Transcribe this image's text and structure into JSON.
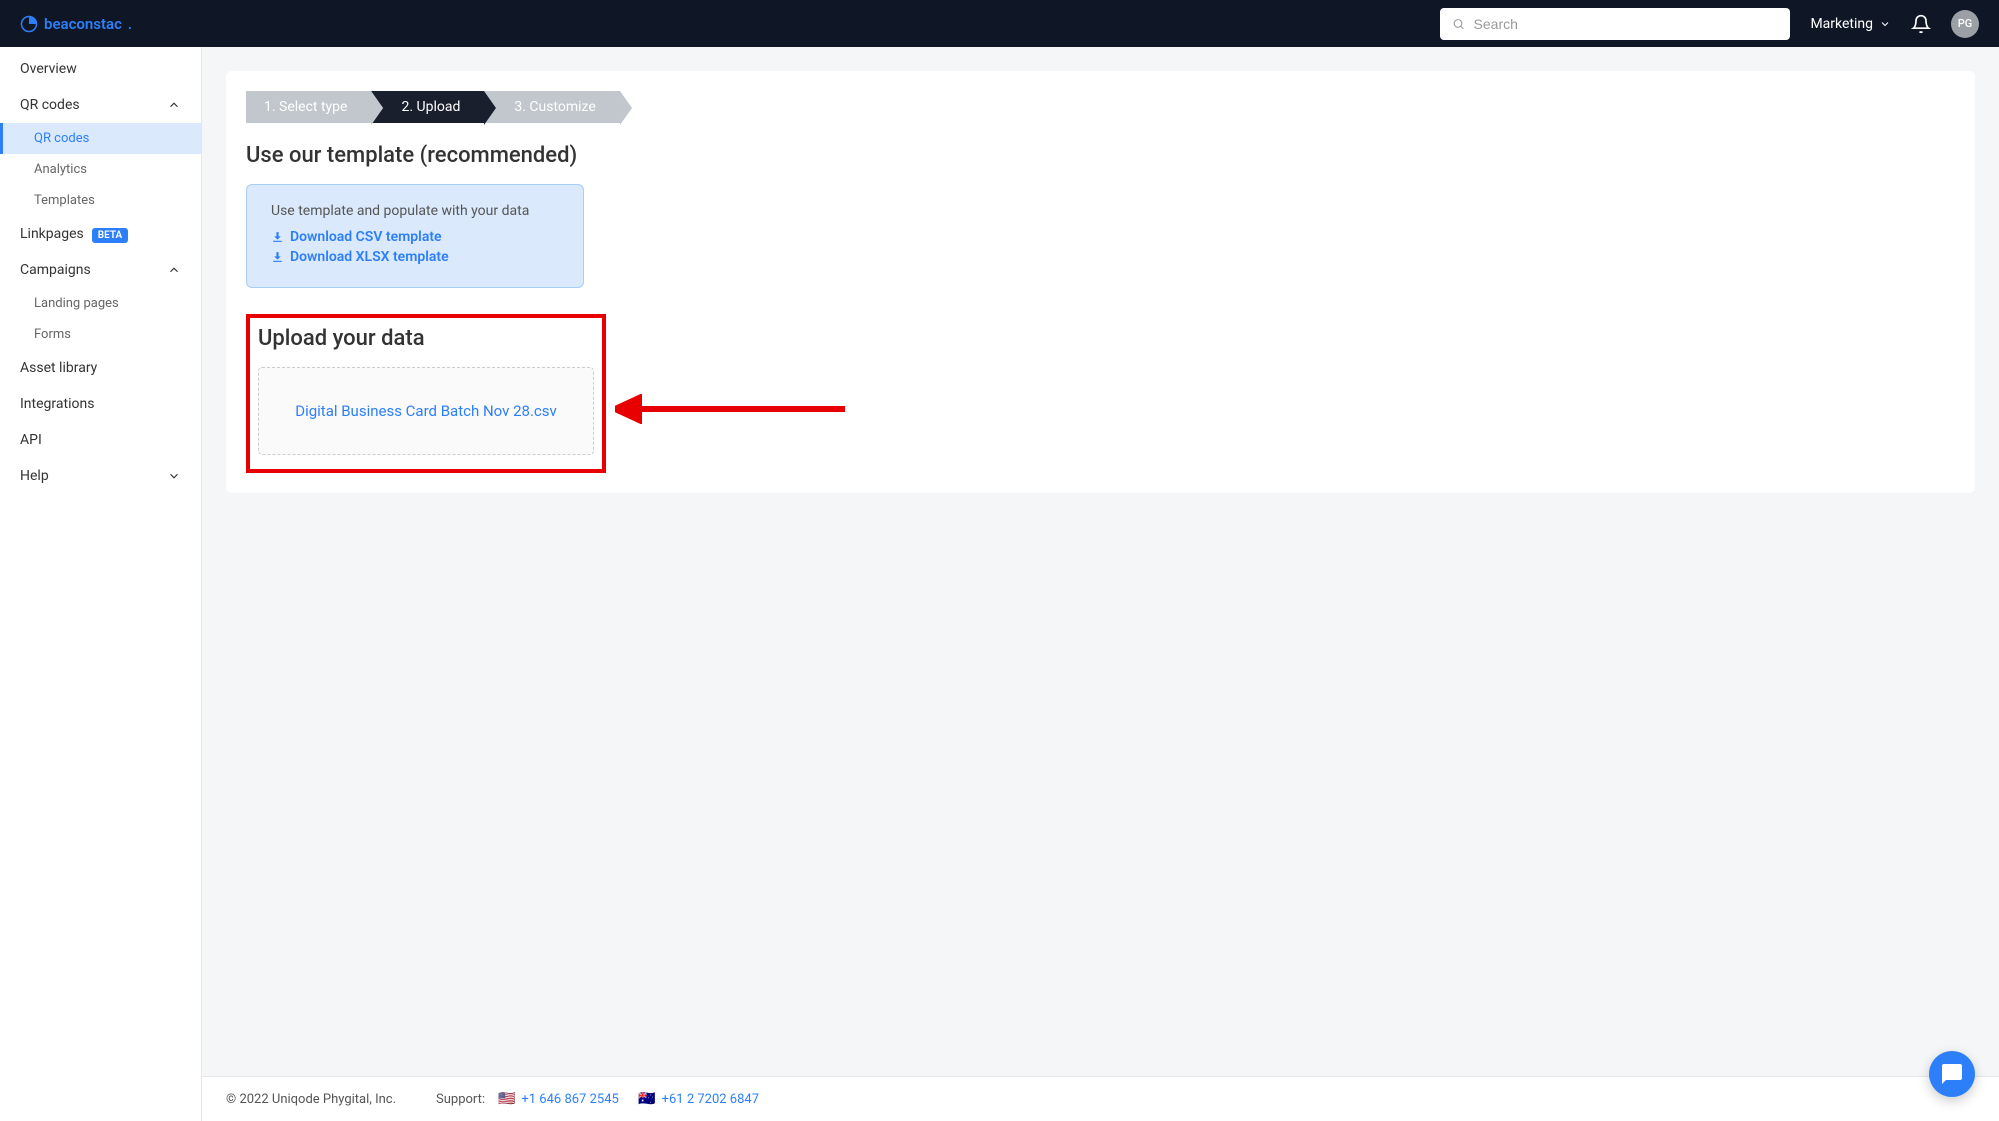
{
  "header": {
    "brand": "beaconstac",
    "search_placeholder": "Search",
    "dropdown_label": "Marketing",
    "avatar_initials": "PG"
  },
  "sidebar": {
    "overview": "Overview",
    "qr_codes": "QR codes",
    "qr_sub": {
      "codes": "QR codes",
      "analytics": "Analytics",
      "templates": "Templates"
    },
    "linkpages": "Linkpages",
    "linkpages_badge": "BETA",
    "campaigns": "Campaigns",
    "campaigns_sub": {
      "landing": "Landing pages",
      "forms": "Forms"
    },
    "asset_library": "Asset library",
    "integrations": "Integrations",
    "api": "API",
    "help": "Help"
  },
  "steps": {
    "s1": "1. Select type",
    "s2": "2. Upload",
    "s3": "3. Customize"
  },
  "template": {
    "title": "Use our template (recommended)",
    "desc": "Use template and populate with your data",
    "csv": "Download CSV template",
    "xlsx": "Download XLSX template"
  },
  "upload": {
    "title": "Upload your data",
    "filename": "Digital Business Card Batch Nov 28.csv"
  },
  "footer": {
    "copyright": "© 2022 Uniqode Phygital, Inc.",
    "support_label": "Support:",
    "phone_us": "+1 646 867 2545",
    "phone_au": "+61 2 7202 6847"
  }
}
